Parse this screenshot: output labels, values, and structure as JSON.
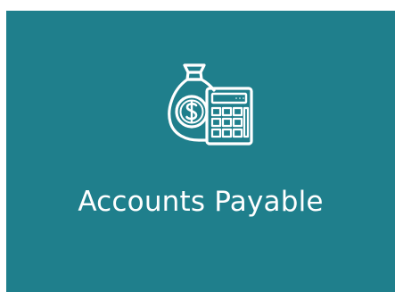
{
  "tile": {
    "label": "Accounts Payable",
    "icon": "money-bag-calculator-icon",
    "background_color": "#1f7f8c",
    "text_color": "#ffffff"
  }
}
